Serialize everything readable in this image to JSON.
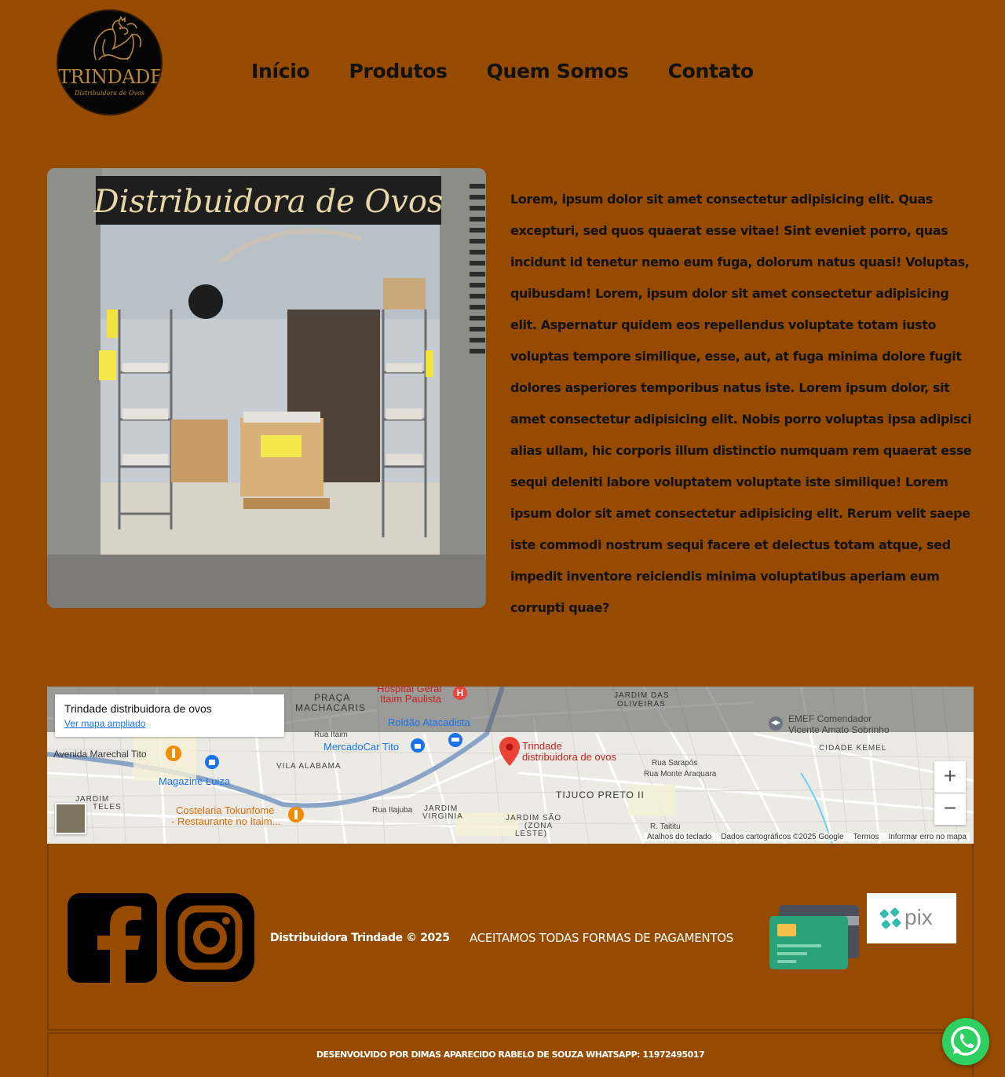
{
  "header": {
    "logo": {
      "title": "TRINDADE",
      "subtitle": "Distribuidora de Ovos"
    },
    "nav": [
      {
        "label": "Início"
      },
      {
        "label": "Produtos"
      },
      {
        "label": "Quem Somos"
      },
      {
        "label": "Contato"
      }
    ]
  },
  "hero": {
    "sign_text": "Distribuidora de Ovos",
    "paragraph": "Lorem, ipsum dolor sit amet consectetur adipisicing elit. Quas excepturi, sed quos quaerat esse vitae! Sint eveniet porro, quas incidunt id tenetur nemo eum fuga, dolorum natus quasi! Voluptas, quibusdam! Lorem, ipsum dolor sit amet consectetur adipisicing elit. Aspernatur quidem eos repellendus voluptate totam iusto voluptas tempore similique, esse, aut, at fuga minima dolore fugit dolores asperiores temporibus natus iste. Lorem ipsum dolor, sit amet consectetur adipisicing elit. Nobis porro voluptas ipsa adipisci alias ullam, hic corporis illum distinctio numquam rem quaerat esse sequi deleniti labore voluptatem voluptate iste similique! Lorem ipsum dolor sit amet consectetur adipisicing elit. Rerum velit saepe iste commodi nostrum sequi facere et delectus totam atque, sed impedit inventore reiciendis minima voluptatibus aperiam eum corrupti quae?"
  },
  "map": {
    "card_title": "Trindade distribuidora de ovos",
    "card_link": "Ver mapa ampliado",
    "pin_label_1": "Trindade",
    "pin_label_2": "distribuidora de ovos",
    "labels": {
      "hospital": "Hospital Geral",
      "hospital2": "Itaim Paulista",
      "praca": "PRAÇA",
      "machacaris": "MACHACARIS",
      "jardim_oliveiras": "JARDIM DAS",
      "oliveiras": "OLIVEIRAS",
      "roldao": "Roldão Atacadista",
      "mercadocar": "MercadoCar Tito",
      "emef1": "EMEF Comendador",
      "emef2": "Vicente Amato Sobrinho",
      "cidade_kemel": "CIDADE KEMEL",
      "av_marechal": "Avenida Marechal Tito",
      "vila_alabama": "VILA ALABAMA",
      "magazine": "Magazine Luiza",
      "jardim_teles": "JARDIM",
      "teles": "TELES",
      "costelaria1": "Costelaria Tokunfome",
      "costelaria2": "- Restaurante no Itaim...",
      "jardim_virginia": "JARDIM",
      "virginia": "VIRGINIA",
      "tijuco": "TIJUCO PRETO II",
      "rua_sarapos": "Rua Sarapós",
      "rua_monte": "Rua Monte Araquara",
      "jardim_sao": "JARDIM SÃO",
      "zona": "(ZONA",
      "leste": "LESTE)",
      "taititu": "R. Taititu",
      "rua_itaim": "Rua Itaim",
      "rua_itajuba": "Rua Itajuba"
    },
    "zoom_in": "+",
    "zoom_out": "−",
    "footer": [
      "Atalhos do teclado",
      "Dados cartográficos ©2025 Google",
      "Termos",
      "Informar erro no mapa"
    ]
  },
  "footer": {
    "copyright": "Distribuidora Trindade © 2025",
    "payments": "ACEITAMOS TODAS FORMAS DE PAGAMENTOS",
    "pix_label": "pix",
    "developer": "DESENVOLVIDO POR DIMAS APARECIDO RABELO DE SOUZA WHATSAPP: 11972495017"
  },
  "colors": {
    "background": "#964b00",
    "nav_text": "#111111",
    "footer_text": "#ffffff",
    "whatsapp": "#2fd062",
    "map_link": "#1a73e8"
  },
  "icons": [
    "rooster-logo-icon",
    "facebook-icon",
    "instagram-icon",
    "credit-card-icon",
    "pix-icon",
    "whatsapp-icon",
    "map-pin-icon"
  ]
}
